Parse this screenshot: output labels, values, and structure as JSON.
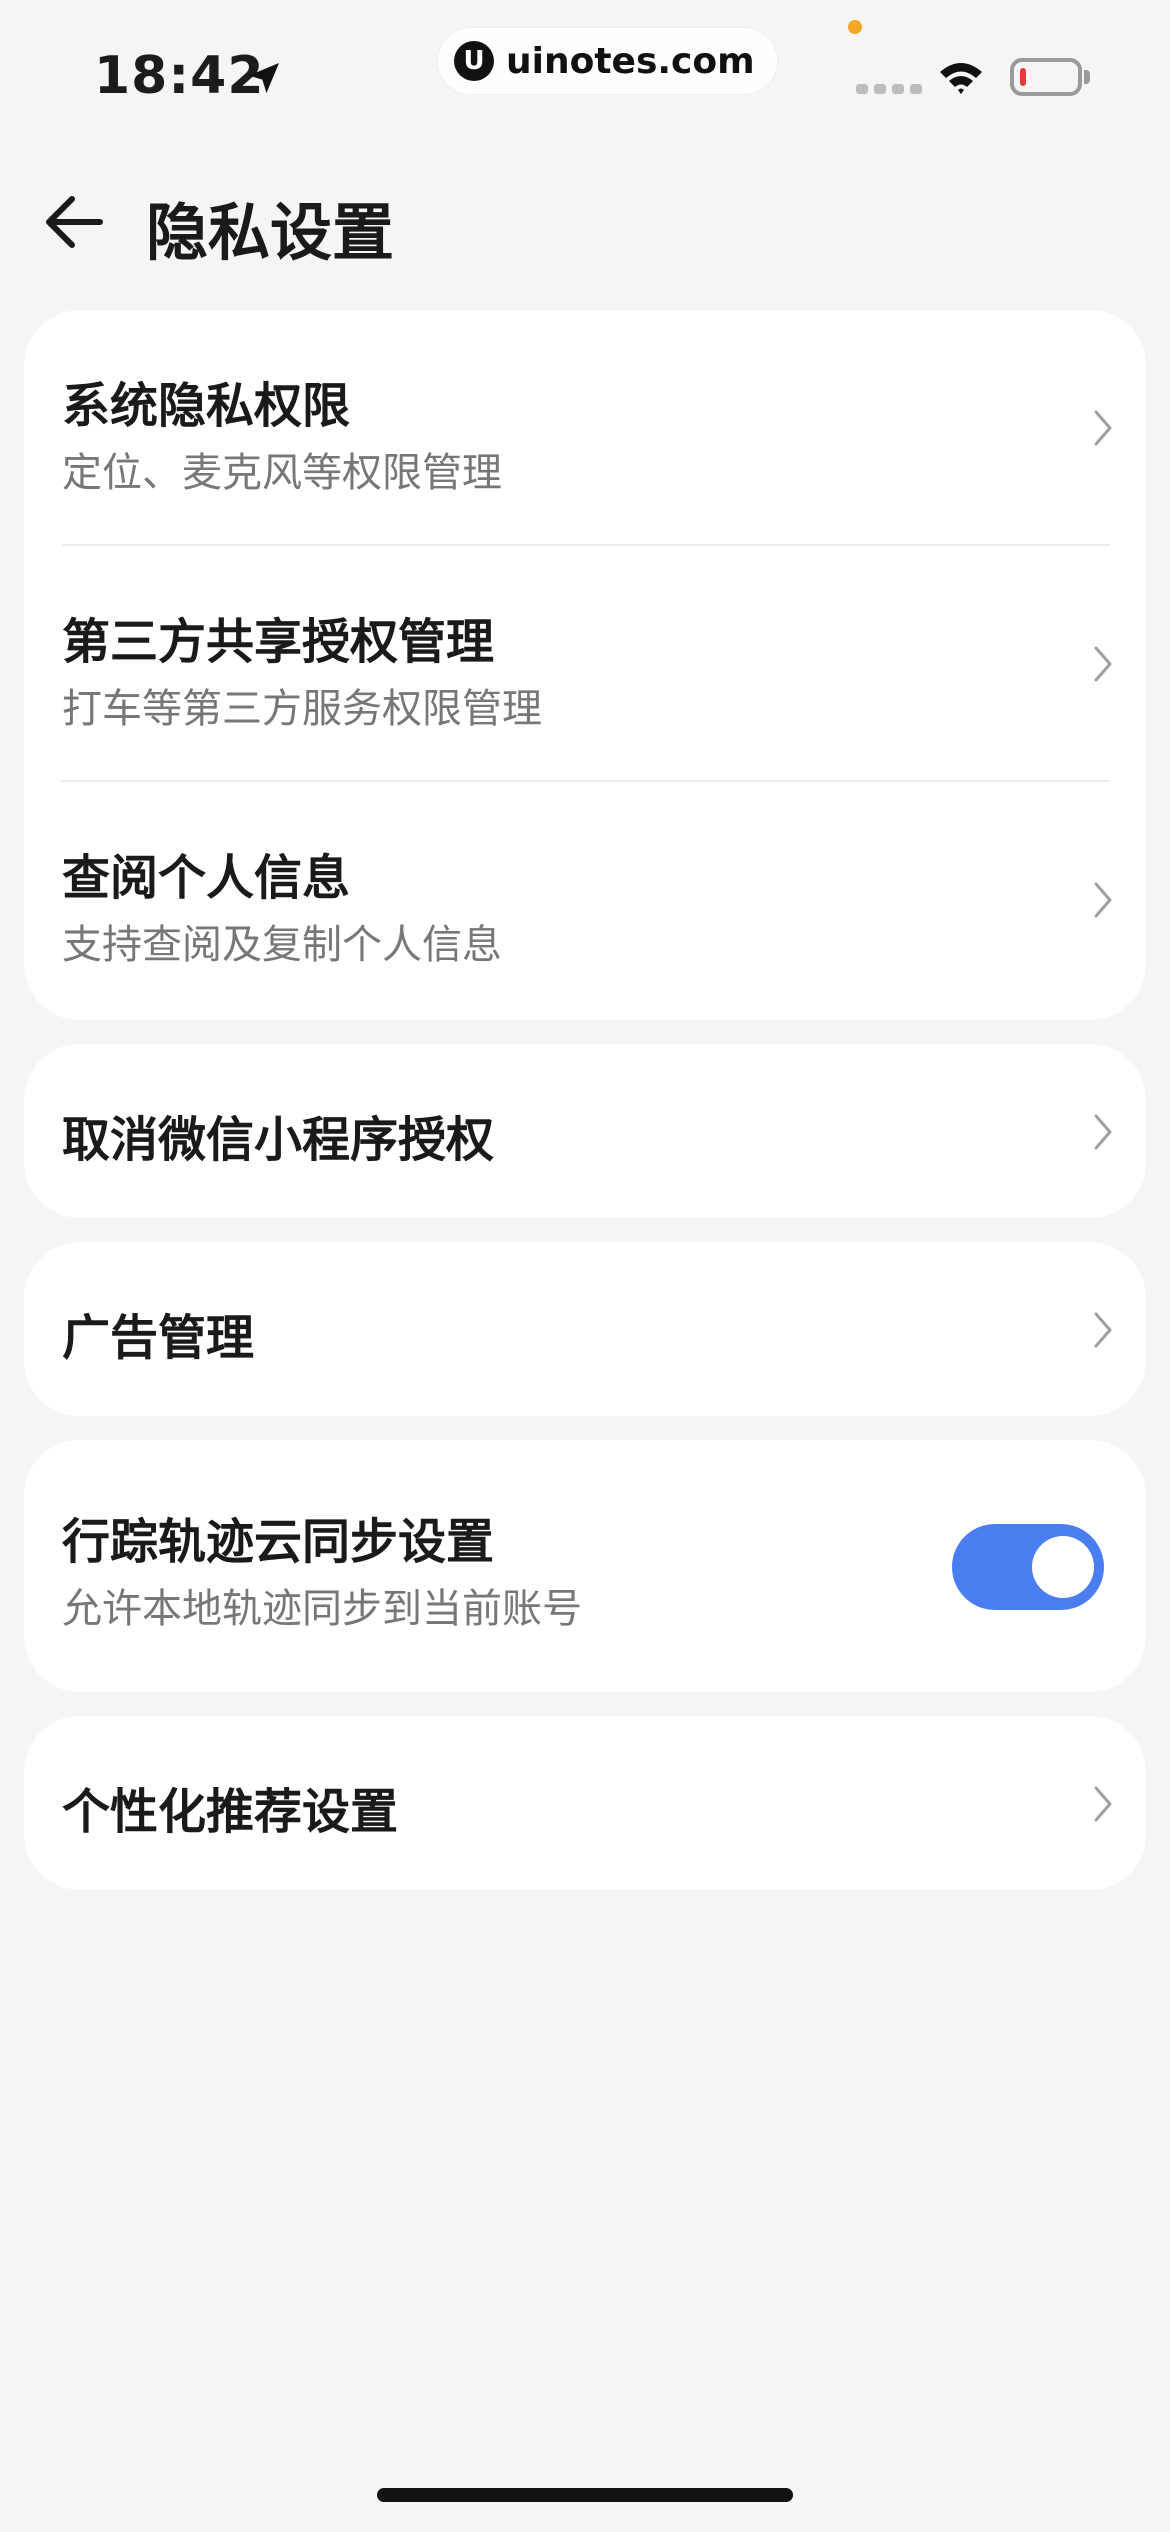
{
  "status_bar": {
    "time": "18:42",
    "watermark_text": "uinotes.com",
    "watermark_logo": "U",
    "battery_level": 0.1,
    "icons": [
      "location-arrow-icon",
      "signal-icon",
      "wifi-icon",
      "battery-icon"
    ]
  },
  "header": {
    "back_icon": "back-arrow-icon",
    "title": "隐私设置"
  },
  "group1": [
    {
      "title": "系统隐私权限",
      "subtitle": "定位、麦克风等权限管理"
    },
    {
      "title": "第三方共享授权管理",
      "subtitle": "打车等第三方服务权限管理"
    },
    {
      "title": "查阅个人信息",
      "subtitle": "支持查阅及复制个人信息"
    }
  ],
  "wechat_auth": {
    "title": "取消微信小程序授权"
  },
  "ads": {
    "title": "广告管理"
  },
  "track_sync": {
    "title": "行踪轨迹云同步设置",
    "subtitle": "允许本地轨迹同步到当前账号",
    "enabled": true
  },
  "personalized": {
    "title": "个性化推荐设置"
  },
  "colors": {
    "background": "#f5f5f5",
    "card": "#ffffff",
    "toggle_on": "#4a7ef0",
    "subtitle_text": "#777777"
  }
}
